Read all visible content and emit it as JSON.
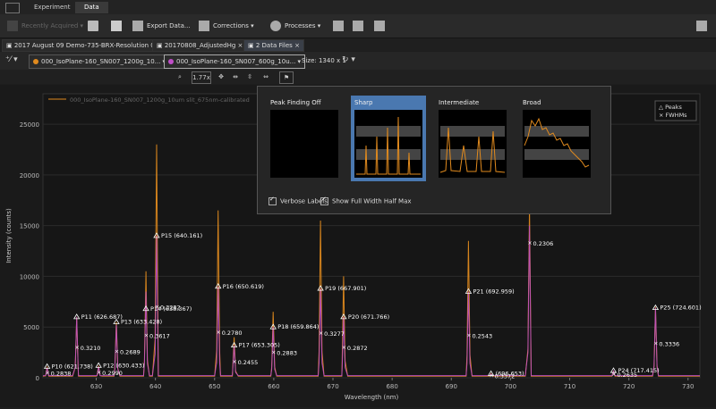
{
  "menubar": {
    "tabs": [
      "Experiment",
      "Data"
    ],
    "active": 1
  },
  "ribbon": {
    "recently_acquired": "Recently Acquired",
    "export": "Export Data...",
    "corrections": "Corrections",
    "processes": "Processes"
  },
  "doc_tabs": [
    {
      "label": "2017 August 09  Demo-735-BRX-Resolution 05",
      "active": false
    },
    {
      "label": "20170808_AdjustedHg",
      "active": false
    },
    {
      "label": "2 Data Files",
      "active": true
    }
  ],
  "data_tabs": {
    "files": [
      {
        "label": "000_IsoPlane-160_SN007_1200g_10...",
        "color": "#e08a1e"
      },
      {
        "label": "000_IsoPlane-160_SN007_600g_10u...",
        "color": "#c04fc8"
      }
    ],
    "size_label": "Size: 1340 x 1"
  },
  "toolrow": {
    "zoom": "1.77x"
  },
  "popup": {
    "options": [
      "Peak Finding Off",
      "Sharp",
      "Intermediate",
      "Broad"
    ],
    "selected": 1,
    "verbose": "Verbose Labels",
    "fwhm": "Show Full Width Half Max"
  },
  "chart_data": {
    "type": "line",
    "xlabel": "Wavelength (nm)",
    "ylabel": "Intensity (counts)",
    "xlim": [
      621,
      732
    ],
    "ylim": [
      0,
      28000
    ],
    "xticks": [
      630,
      640,
      650,
      660,
      670,
      680,
      690,
      700,
      710,
      720,
      730
    ],
    "yticks": [
      0,
      5000,
      10000,
      15000,
      20000,
      25000
    ],
    "legend_entry": "000_IsoPlane-160_SN007_1200g_10um slit_675nm-calibrated",
    "legend_marks": {
      "peaks": "Peaks",
      "fwhm": "FWHMs"
    },
    "series": [
      {
        "name": "000_IsoPlane-160_SN007_1200g_10um slit_675nm-calibrated",
        "color": "#e08a1e",
        "peaks": [
          [
            621.7,
            1100
          ],
          [
            626.7,
            6000
          ],
          [
            630.4,
            1200
          ],
          [
            633.4,
            5500
          ],
          [
            638.4,
            10500
          ],
          [
            640.2,
            23000
          ],
          [
            650.6,
            16500
          ],
          [
            653.3,
            4000
          ],
          [
            659.9,
            6500
          ],
          [
            667.9,
            15500
          ],
          [
            671.8,
            10000
          ],
          [
            692.9,
            13500
          ],
          [
            696.7,
            400
          ],
          [
            703.2,
            17000
          ],
          [
            717.4,
            700
          ],
          [
            724.5,
            7000
          ]
        ]
      },
      {
        "name": "600g",
        "color": "#c04fc8",
        "peaks": [
          [
            621.7,
            1000
          ],
          [
            626.7,
            6000
          ],
          [
            630.4,
            1100
          ],
          [
            633.4,
            5200
          ],
          [
            638.4,
            8500
          ],
          [
            640.2,
            14000
          ],
          [
            650.6,
            9000
          ],
          [
            653.3,
            3200
          ],
          [
            659.9,
            5000
          ],
          [
            667.9,
            8800
          ],
          [
            671.8,
            6000
          ],
          [
            692.9,
            8500
          ],
          [
            696.7,
            350
          ],
          [
            703.2,
            15000
          ],
          [
            717.4,
            650
          ],
          [
            724.5,
            6900
          ]
        ]
      }
    ],
    "peak_labels": [
      {
        "label": "P10 (621.738)",
        "x": 621.7,
        "y": 1100
      },
      {
        "label": "P11 (626.687)",
        "x": 626.7,
        "y": 6000
      },
      {
        "label": "P12 (630.433)",
        "x": 630.4,
        "y": 1200
      },
      {
        "label": "P13 (633.428)",
        "x": 633.4,
        "y": 5500
      },
      {
        "label": "P14 (638.367)",
        "x": 638.4,
        "y": 6800
      },
      {
        "label": "P15 (640.161)",
        "x": 640.2,
        "y": 14000
      },
      {
        "label": "P16 (650.619)",
        "x": 650.6,
        "y": 9000
      },
      {
        "label": "P17 (653.305)",
        "x": 653.3,
        "y": 3200
      },
      {
        "label": "P18 (659.864)",
        "x": 659.9,
        "y": 5000
      },
      {
        "label": "P19 (667.901)",
        "x": 667.9,
        "y": 8800
      },
      {
        "label": "P20 (671.766)",
        "x": 671.8,
        "y": 6000
      },
      {
        "label": "P21 (692.959)",
        "x": 692.9,
        "y": 8500
      },
      {
        "label": "(696.653)",
        "x": 696.7,
        "y": 400
      },
      {
        "label": "P24 (717.415)",
        "x": 717.4,
        "y": 700
      },
      {
        "label": "P25 (724.601)",
        "x": 724.5,
        "y": 6900
      }
    ],
    "fwhm_labels": [
      {
        "label": "0.2838",
        "x": 621.7,
        "y": 500
      },
      {
        "label": "0.3210",
        "x": 626.7,
        "y": 3000
      },
      {
        "label": "0.2990",
        "x": 630.4,
        "y": 550
      },
      {
        "label": "0.2689",
        "x": 633.4,
        "y": 2600
      },
      {
        "label": "0.3617",
        "x": 638.4,
        "y": 4200
      },
      {
        "label": "0.3282",
        "x": 640.2,
        "y": 7000
      },
      {
        "label": "0.2780",
        "x": 650.6,
        "y": 4500
      },
      {
        "label": "0.2455",
        "x": 653.3,
        "y": 1600
      },
      {
        "label": "0.2883",
        "x": 659.9,
        "y": 2500
      },
      {
        "label": "0.3277",
        "x": 667.9,
        "y": 4400
      },
      {
        "label": "0.2872",
        "x": 671.8,
        "y": 3000
      },
      {
        "label": "0.2543",
        "x": 692.9,
        "y": 4200
      },
      {
        "label": "0.3372",
        "x": 696.7,
        "y": 200
      },
      {
        "label": "0.2306",
        "x": 703.2,
        "y": 13300
      },
      {
        "label": "0.2635",
        "x": 717.4,
        "y": 350
      },
      {
        "label": "0.3336",
        "x": 724.5,
        "y": 3400
      }
    ]
  }
}
